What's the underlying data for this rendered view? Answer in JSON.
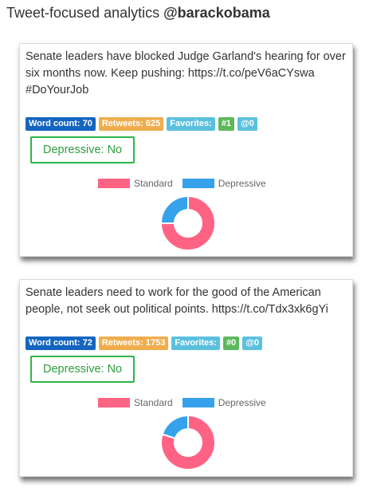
{
  "header": {
    "prefix": "Tweet-focused analytics ",
    "handle": "@barackobama"
  },
  "colors": {
    "standard": "#ff6384",
    "depressive": "#36a2eb",
    "word_badge": "#1565c0",
    "retweets_badge": "#f0ad4e",
    "favorites_badge": "#5bc0de",
    "hashtag_badge": "#5cb85c",
    "mention_badge": "#5bc0de",
    "depressive_box": "#2bb54a"
  },
  "tweets": [
    {
      "text": "Senate leaders have blocked Judge Garland's hearing for over six months now. Keep pushing: https://t.co/peV6aCYswa #DoYourJob",
      "word_count": "Word count: 70",
      "retweets": "Retweets: 625",
      "favorites": "Favorites:",
      "hashtags": "#1",
      "mentions": "@0",
      "depressive_label": "Depressive: No",
      "chart_data": {
        "type": "pie",
        "categories": [
          "Standard",
          "Depressive"
        ],
        "values": [
          75,
          25
        ]
      }
    },
    {
      "text": "Senate leaders need to work for the good of the American people, not seek out political points. https://t.co/Tdx3xk6gYi",
      "word_count": "Word count: 72",
      "retweets": "Retweets: 1753",
      "favorites": "Favorites:",
      "hashtags": "#0",
      "mentions": "@0",
      "depressive_label": "Depressive: No",
      "chart_data": {
        "type": "pie",
        "categories": [
          "Standard",
          "Depressive"
        ],
        "values": [
          80,
          20
        ]
      }
    }
  ],
  "legend": {
    "standard": "Standard",
    "depressive": "Depressive"
  }
}
